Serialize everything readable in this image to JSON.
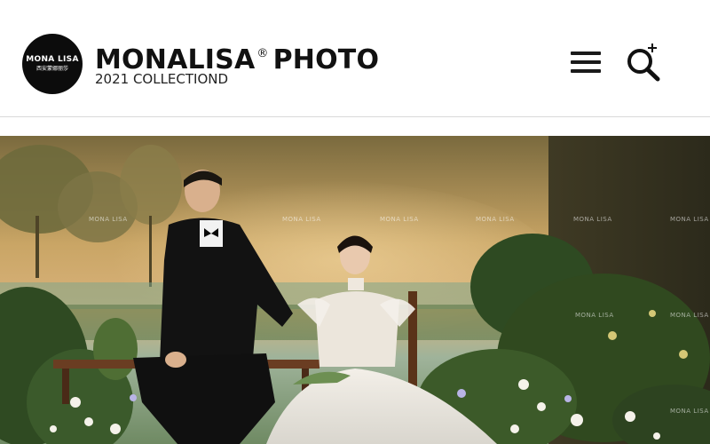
{
  "header": {
    "logo": {
      "title": "MONA LISA",
      "subtitle": "西安蒙娜丽莎"
    },
    "brand": {
      "name": "MONALISA",
      "registered_mark": "®",
      "name_suffix": "PHOTO",
      "subtitle": "2021 COLLECTIOND"
    },
    "icons": {
      "menu": "hamburger-menu-icon",
      "search": "search-plus-icon"
    }
  },
  "hero": {
    "watermark": "MONA LISA"
  },
  "colors": {
    "background": "#ffffff",
    "text": "#111111",
    "logo_badge": "#0c0c0c",
    "divider": "#d9d9d9"
  }
}
